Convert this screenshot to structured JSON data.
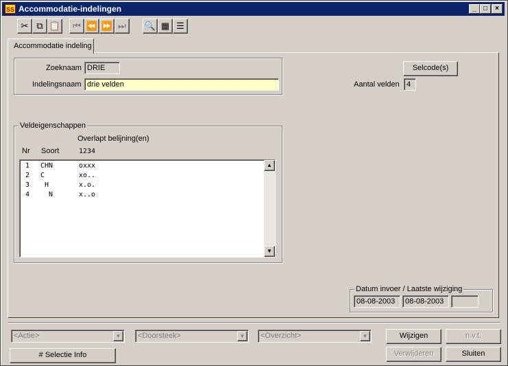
{
  "window": {
    "title": "Accommodatie-indelingen",
    "app_icon": "SS",
    "controls": [
      "minimize-icon",
      "maximize-icon",
      "close-icon"
    ]
  },
  "toolbar": {
    "buttons": [
      {
        "icon": "cut-icon",
        "glyph": "✂",
        "enabled": true
      },
      {
        "icon": "copy-icon",
        "glyph": "⧉",
        "enabled": true
      },
      {
        "icon": "paste-icon",
        "glyph": "📋",
        "enabled": true
      },
      {
        "icon": "first-record-icon",
        "glyph": "⏮",
        "enabled": false
      },
      {
        "icon": "previous-record-icon",
        "glyph": "⏪",
        "enabled": false
      },
      {
        "icon": "next-record-icon",
        "glyph": "⏩",
        "enabled": false
      },
      {
        "icon": "last-record-icon",
        "glyph": "⏭",
        "enabled": false
      },
      {
        "icon": "search-icon",
        "glyph": "🔍",
        "enabled": true
      },
      {
        "icon": "table-view-icon",
        "glyph": "▦",
        "enabled": true
      },
      {
        "icon": "form-view-icon",
        "glyph": "☰",
        "enabled": true
      }
    ]
  },
  "tab": {
    "label": "Accommodatie indeling"
  },
  "form": {
    "zoeknaam_label": "Zoeknaam",
    "zoeknaam_value": "DRIE",
    "indelingsnaam_label": "Indelingsnaam",
    "indelingsnaam_value": "drie velden",
    "selcode_button": "Selcode(s)",
    "aantal_velden_label": "Aantal velden",
    "aantal_velden_value": "4"
  },
  "veldeigenschappen": {
    "legend": "Veldeigenschappen",
    "overlap_header": "Overlapt belijning(en)",
    "col_nr": "Nr",
    "col_soort": "Soort",
    "col_digits": "1234",
    "rows": [
      {
        "nr": "1",
        "soort": "CHN",
        "overlap": "oxxx"
      },
      {
        "nr": "2",
        "soort": "C",
        "overlap": "xo.."
      },
      {
        "nr": "3",
        "soort": " H",
        "overlap": "x.o."
      },
      {
        "nr": "4",
        "soort": "  N",
        "overlap": "x..o"
      }
    ]
  },
  "datum": {
    "legend": "Datum invoer / Laatste wijziging",
    "invoer": "08-08-2003",
    "wijziging": "08-08-2003",
    "extra": ""
  },
  "bottom": {
    "actie": "<Actie>",
    "doorsteek": "<Doorsteek>",
    "overzicht": "<Overzicht>",
    "wijzigen": "Wijzigen",
    "nvt": "n.v.t.",
    "verwijderen": "Verwijderen",
    "sluiten": "Sluiten",
    "selectie_info": "# Selectie Info"
  }
}
